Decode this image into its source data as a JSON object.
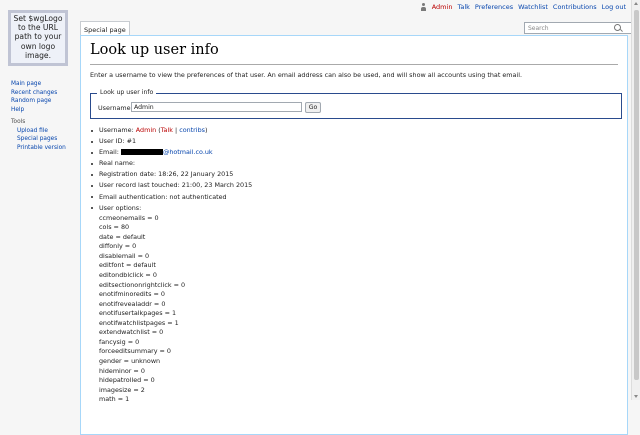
{
  "logo": {
    "text": "Set $wgLogo to the URL path to your own logo image."
  },
  "personal": {
    "user": "Admin",
    "talk": "Talk",
    "preferences": "Preferences",
    "watchlist": "Watchlist",
    "contributions": "Contributions",
    "logout": "Log out"
  },
  "tabs": {
    "special": "Special page"
  },
  "search": {
    "placeholder": "Search"
  },
  "page": {
    "title": "Look up user info",
    "intro": "Enter a username to view the preferences of that user. An email address can also be used, and will show all accounts using that email."
  },
  "form": {
    "legend": "Look up user info",
    "label": "Username:",
    "value": "Admin",
    "button": "Go"
  },
  "info": {
    "username_label": "Username:",
    "username": "Admin",
    "talk": "Talk",
    "separator": "|",
    "contribs": "contribs",
    "user_id": "User ID: #1",
    "email_label": "Email:",
    "email_domain": "@hotmail.co.uk",
    "real_name": "Real name:",
    "registration": "Registration date: 18:26, 22 January 2015",
    "touched": "User record last touched: 21:00, 23 March 2015",
    "email_auth": "Email authentication: not authenticated",
    "options_label": "User options:",
    "options": [
      "ccmeonemails = 0",
      "cols = 80",
      "date = default",
      "diffonly = 0",
      "disablemail = 0",
      "editfont = default",
      "editondblclick = 0",
      "editsectiononrightclick = 0",
      "enotifminoredits = 0",
      "enotifrevealaddr = 0",
      "enotifusertalkpages = 1",
      "enotifwatchlistpages = 1",
      "extendwatchlist = 0",
      "fancysig = 0",
      "forceeditsummary = 0",
      "gender = unknown",
      "hideminor = 0",
      "hidepatrolled = 0",
      "imagesize = 2",
      "math = 1"
    ]
  },
  "sidebar": {
    "nav": [
      "Main page",
      "Recent changes",
      "Random page",
      "Help"
    ],
    "tools_heading": "Tools",
    "tools": [
      "Upload file",
      "Special pages",
      "Printable version"
    ]
  },
  "colors": {
    "link": "#0645ad",
    "redlink": "#ba0000",
    "border": "#a7d7f9",
    "fieldset": "#2a4b8d"
  }
}
